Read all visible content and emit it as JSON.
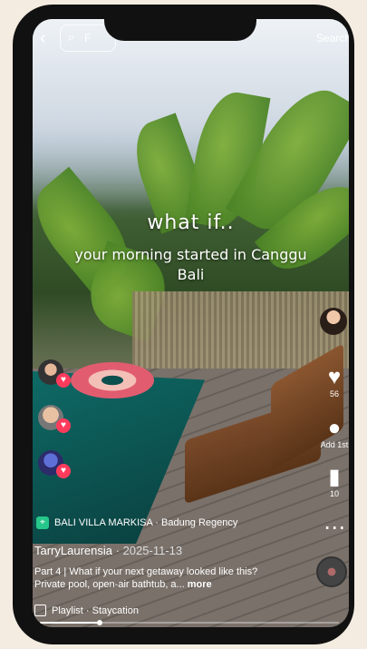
{
  "topbar": {
    "back_icon": "back-arrow-icon",
    "search_placeholder": "F",
    "search_link": "Search"
  },
  "video_overlay": {
    "line1": "what if..",
    "line2": "your morning started in Canggu",
    "line3": "Bali"
  },
  "rail": {
    "like_count": "56",
    "comment_label": "Add 1st",
    "bookmark_count": "10",
    "more_icon": "more-dots-icon"
  },
  "location": {
    "name": "BALI VILLA MARKISA · Badung Regency"
  },
  "author": {
    "name": "TarryLaurensia",
    "date": "· 2025-11-13"
  },
  "caption": {
    "text": "Part 4 | What if your next getaway looked like this? Private pool, open-air bathtub, a...",
    "more": "more"
  },
  "playlist": {
    "text": "Playlist · Staycation"
  },
  "progress": {
    "value": 0.2
  },
  "colors": {
    "frame": "#111111",
    "page_bg": "#f4ece1",
    "heart": "#ff3b5c",
    "location_icon": "#25c78a"
  }
}
